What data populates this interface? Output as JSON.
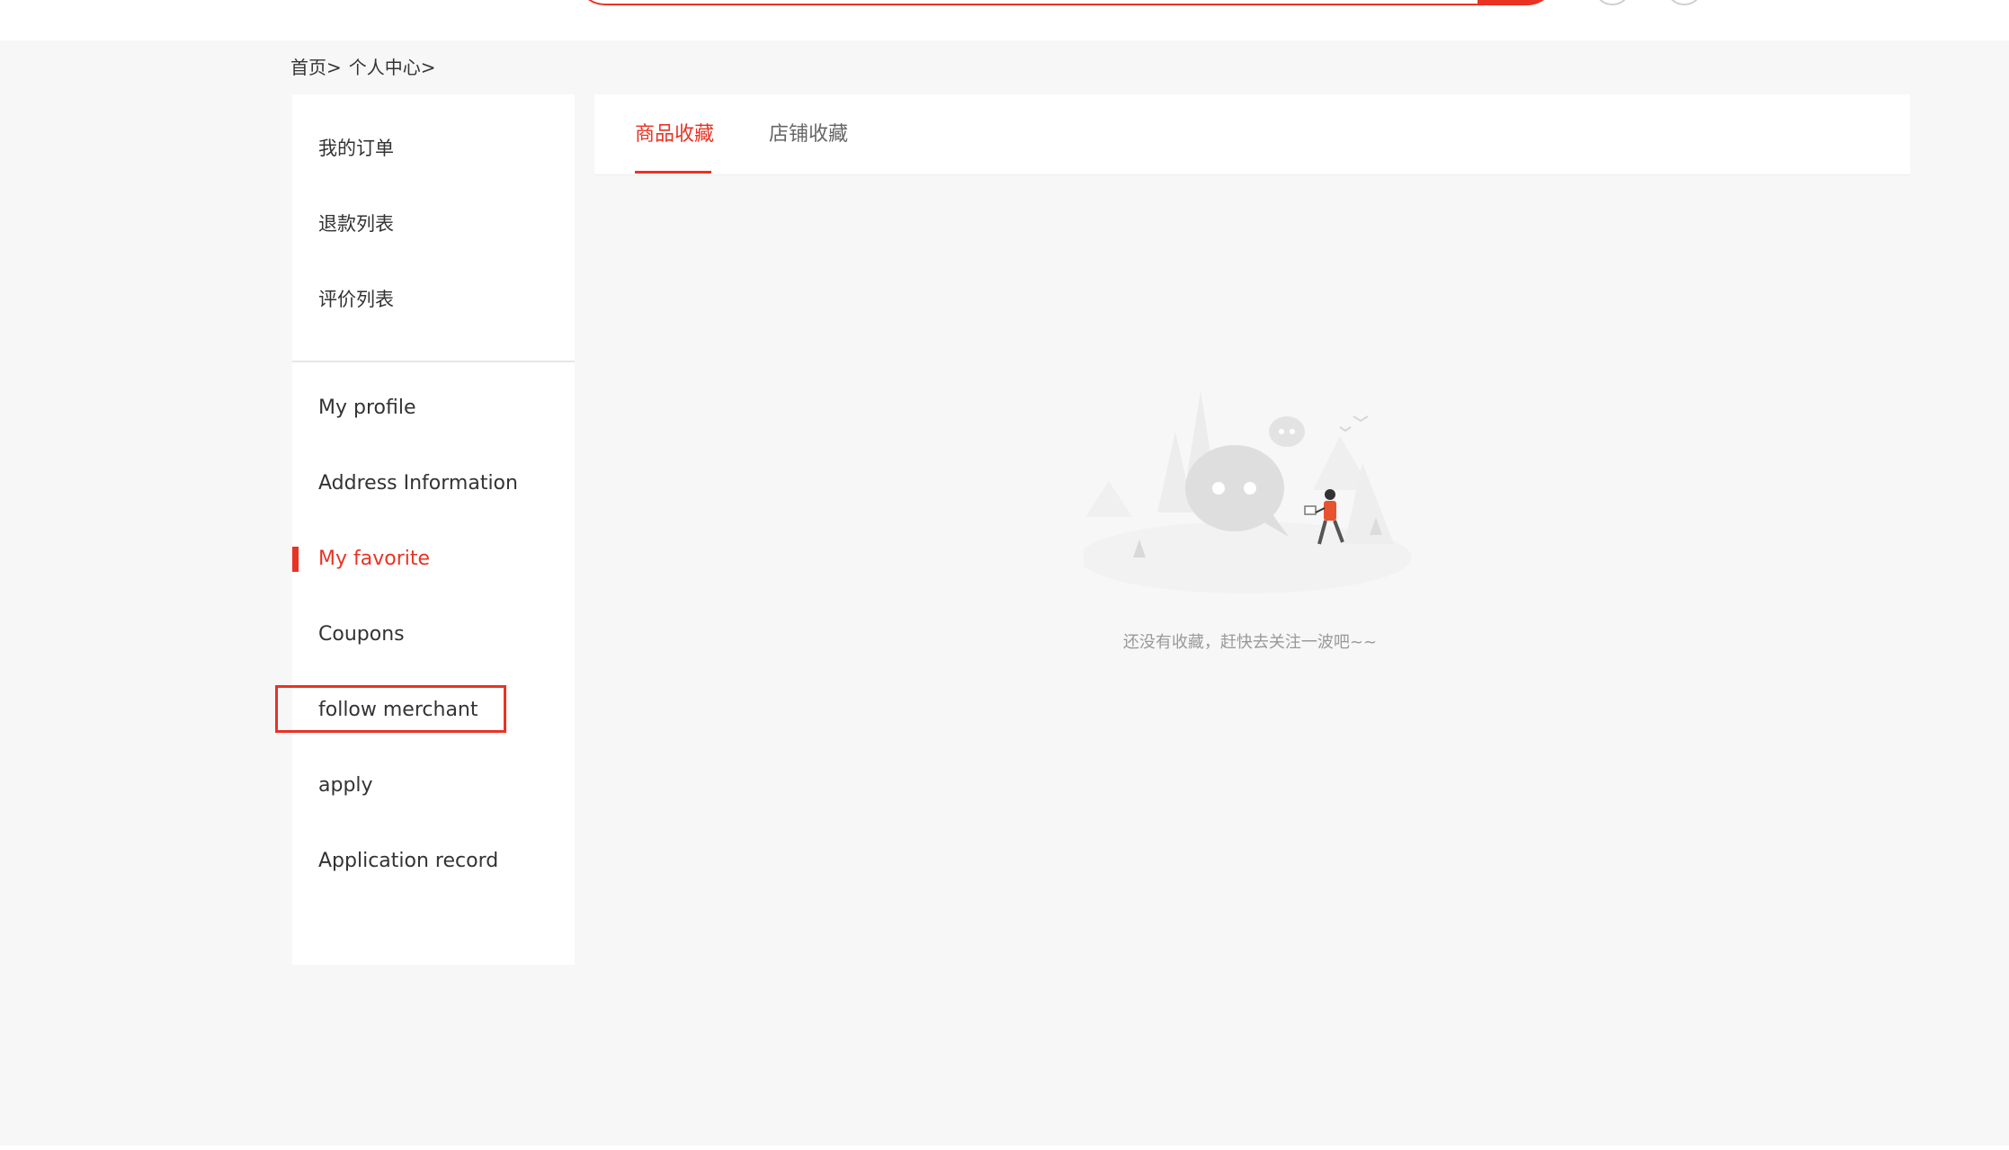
{
  "breadcrumb": {
    "home": "首页>",
    "personal_center": "个人中心>"
  },
  "sidebar": {
    "group1": [
      {
        "label": "我的订单"
      },
      {
        "label": "退款列表"
      },
      {
        "label": "评价列表"
      }
    ],
    "group2": [
      {
        "label": "My profile"
      },
      {
        "label": "Address Information"
      },
      {
        "label": "My favorite"
      },
      {
        "label": "Coupons"
      },
      {
        "label": "follow merchant"
      },
      {
        "label": "apply"
      },
      {
        "label": "Application record"
      }
    ],
    "active_item": "My favorite"
  },
  "tabs": [
    {
      "label": "商品收藏"
    },
    {
      "label": "店铺收藏"
    }
  ],
  "empty_state": {
    "message": "还没有收藏，赶快去关注一波吧~~"
  },
  "colors": {
    "accent": "#e93323",
    "background": "#f7f7f7"
  }
}
